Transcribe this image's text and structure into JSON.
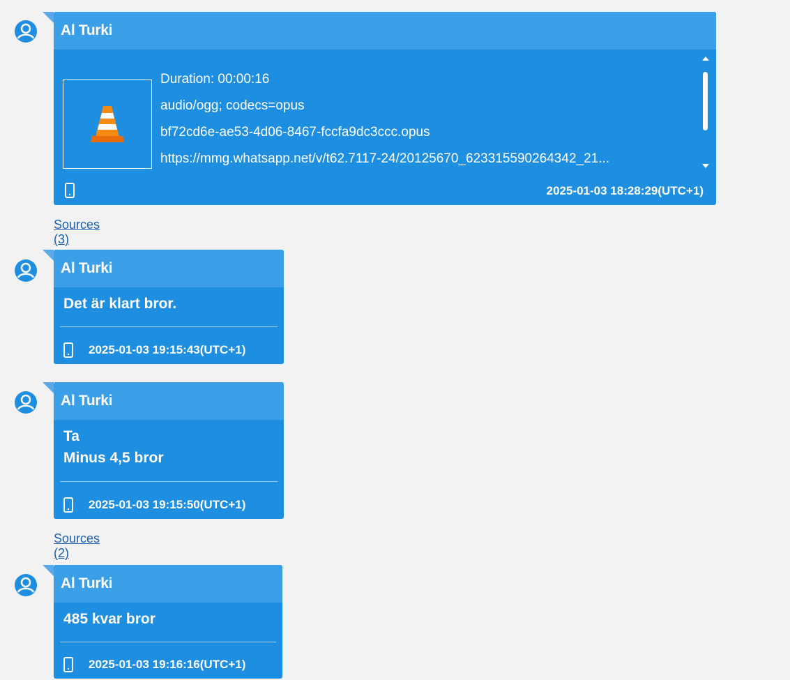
{
  "messages": [
    {
      "sender": "Al Turki",
      "attachment": {
        "duration": "Duration: 00:00:16",
        "mime": "audio/ogg; codecs=opus",
        "filename": "bf72cd6e-ae53-4d06-8467-fccfa9dc3ccc.opus",
        "url": "https://mmg.whatsapp.net/v/t62.7117-24/20125670_623315590264342_21...",
        "icon": "vlc-cone-icon"
      },
      "timestamp": "2025-01-03 18:28:29(UTC+1)",
      "sources": "Sources (3)"
    },
    {
      "sender": "Al Turki",
      "text": "Det är klart bror.",
      "timestamp": "2025-01-03 19:15:43(UTC+1)"
    },
    {
      "sender": "Al Turki",
      "text_line1": "Ta",
      "text_line2": "Minus 4,5 bror",
      "timestamp": "2025-01-03 19:15:50(UTC+1)",
      "sources": "Sources (2)"
    },
    {
      "sender": "Al Turki",
      "text": "485 kvar bror",
      "timestamp": "2025-01-03 19:16:16(UTC+1)"
    }
  ],
  "colors": {
    "bubble": "#1e8fe0",
    "header": "#3a9fe6",
    "link": "#1a5fb0",
    "background": "#f2f2f2"
  }
}
